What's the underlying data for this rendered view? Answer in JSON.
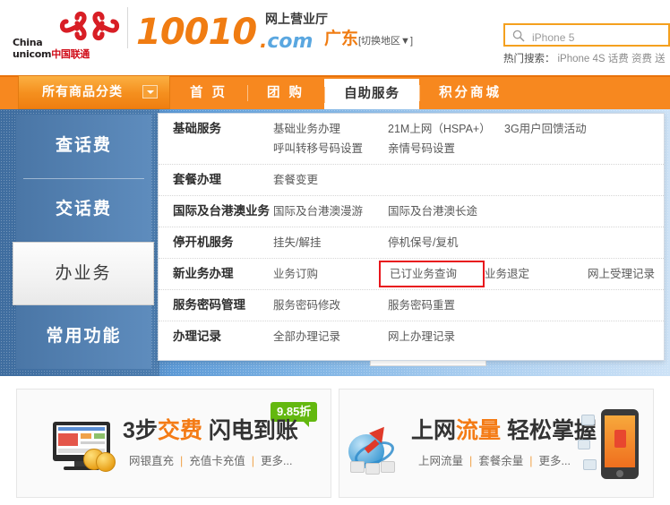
{
  "header": {
    "logo": {
      "en_line1": "China",
      "en_line2": "unicom",
      "cn": "中国联通",
      "icon": "unicom-knot-logo"
    },
    "brand_number": "10010",
    "brand_dotcom": ".com",
    "brand_sub": "网上营业厅",
    "region": "广东",
    "region_switch": "[切换地区▼]",
    "search": {
      "value": "iPhone 5",
      "placeholder": "iPhone 5",
      "icon": "search-icon"
    },
    "hot_search_label": "热门搜索：",
    "hot_search_keywords": "iPhone 4S 话费 资费 送"
  },
  "nav": {
    "category_label": "所有商品分类",
    "category_arrow_icon": "chevron-down-icon",
    "items": [
      {
        "label": "首 页",
        "active": false
      },
      {
        "label": "团 购",
        "active": false
      },
      {
        "label": "自助服务",
        "active": true
      },
      {
        "label": "积分商城",
        "active": false
      }
    ]
  },
  "sidebar": {
    "items": [
      {
        "label": "查话费",
        "active": false
      },
      {
        "label": "交话费",
        "active": false
      },
      {
        "label": "办业务",
        "active": true
      },
      {
        "label": "常用功能",
        "active": false
      }
    ]
  },
  "panel": {
    "rows": [
      {
        "category": "基础服务",
        "links": [
          {
            "label": "基础业务办理",
            "col": "c1",
            "highlighted": false
          },
          {
            "label": "21M上网（HSPA+）",
            "col": "c2",
            "highlighted": false
          },
          {
            "label": "3G用户回馈活动",
            "col": "c4",
            "highlighted": false
          },
          {
            "label": "呼叫转移号码设置",
            "col": "c1",
            "highlighted": false
          },
          {
            "label": "亲情号码设置",
            "col": "c2",
            "highlighted": false
          }
        ]
      },
      {
        "category": "套餐办理",
        "links": [
          {
            "label": "套餐变更",
            "col": "c1",
            "highlighted": false
          }
        ]
      },
      {
        "category": "国际及台港澳业务",
        "links": [
          {
            "label": "国际及台港澳漫游",
            "col": "c1",
            "highlighted": false
          },
          {
            "label": "国际及台港澳长途",
            "col": "c2",
            "highlighted": false
          }
        ]
      },
      {
        "category": "停开机服务",
        "links": [
          {
            "label": "挂失/解挂",
            "col": "c1",
            "highlighted": false
          },
          {
            "label": "停机保号/复机",
            "col": "c2",
            "highlighted": false
          }
        ]
      },
      {
        "category": "新业务办理",
        "links": [
          {
            "label": "业务订购",
            "col": "c1",
            "highlighted": false
          },
          {
            "label": "已订业务查询",
            "col": "c2",
            "highlighted": true
          },
          {
            "label": "业务退定",
            "col": "c3",
            "highlighted": false
          },
          {
            "label": "网上受理记录",
            "col": "c4",
            "highlighted": false
          }
        ]
      },
      {
        "category": "服务密码管理",
        "links": [
          {
            "label": "服务密码修改",
            "col": "c1",
            "highlighted": false
          },
          {
            "label": "服务密码重置",
            "col": "c2",
            "highlighted": false
          }
        ]
      },
      {
        "category": "办理记录",
        "links": [
          {
            "label": "全部办理记录",
            "col": "c1",
            "highlighted": false
          },
          {
            "label": "网上办理记录",
            "col": "c2",
            "highlighted": false
          }
        ]
      }
    ],
    "highlight_color": "#e8161c"
  },
  "promos": [
    {
      "title_plain_1": "3步",
      "title_highlight": "交费",
      "title_plain_2": " 闪电到账",
      "badge": "9.85折",
      "badge_color": "#63b80f",
      "links": [
        "网银直充",
        "充值卡充值",
        "更多..."
      ],
      "icon": "monitor-coins-icon"
    },
    {
      "title_plain_1": "上网",
      "title_highlight": "流量",
      "title_plain_2": " 轻松掌握",
      "badge": "",
      "badge_color": "",
      "links": [
        "上网流量",
        "套餐余量",
        "更多..."
      ],
      "icon": "ie-arrow-keyboard-icon"
    }
  ],
  "colors": {
    "brand_orange": "#f07c12",
    "nav_orange": "#f7881f",
    "stage_blue_dark": "#3d6a9c",
    "stage_blue_light": "#cde2f6",
    "highlight_red": "#e8161c",
    "badge_green": "#63b80f"
  }
}
